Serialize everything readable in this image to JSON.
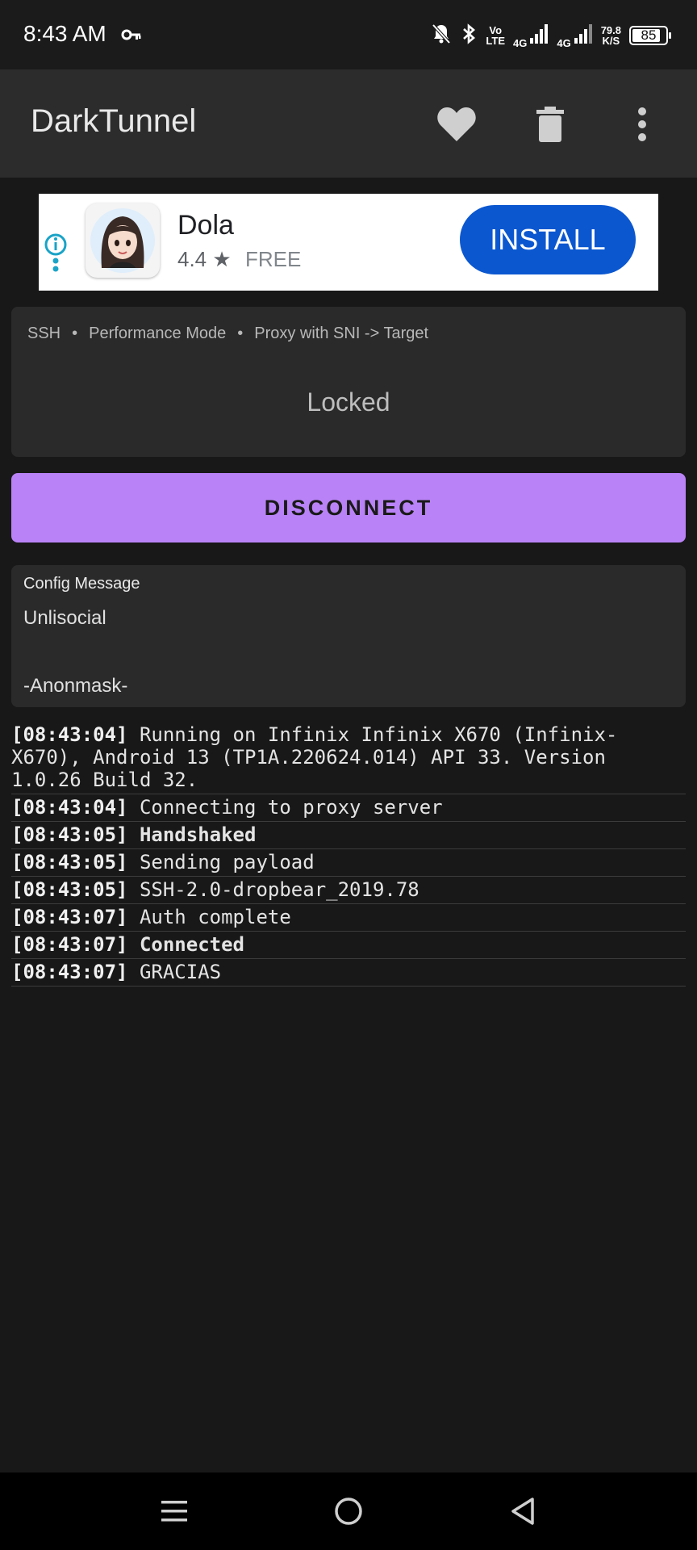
{
  "status_bar": {
    "time": "8:43 AM",
    "volte_top": "Vo",
    "volte_bottom": "LTE",
    "net1": "4G",
    "net2": "4G",
    "speed_value": "79.8",
    "speed_unit": "K/S",
    "battery": "85",
    "icons": [
      "key-icon",
      "bell-off-icon",
      "bluetooth-icon",
      "signal-icon",
      "signal-icon",
      "battery-icon"
    ]
  },
  "app_bar": {
    "title": "DarkTunnel",
    "icons": [
      "heart-icon",
      "trash-icon",
      "more-vert-icon"
    ]
  },
  "ad": {
    "app_name": "Dola",
    "rating": "4.4 ★",
    "price": "FREE",
    "install_label": "INSTALL"
  },
  "mode_card": {
    "crumbs": [
      "SSH",
      "Performance Mode",
      "Proxy with SNI -> Target"
    ],
    "separator": "•",
    "status": "Locked"
  },
  "disconnect_label": "DISCONNECT",
  "config": {
    "label": "Config Message",
    "line1": "Unlisocial",
    "line2": "-Anonmask-"
  },
  "log": [
    {
      "ts": "[08:43:04]",
      "msg": "Running on Infinix Infinix X670 (Infinix-X670), Android 13 (TP1A.220624.014) API 33. Version 1.0.26 Build 32.",
      "bold": false
    },
    {
      "ts": "[08:43:04]",
      "msg": "Connecting to proxy server",
      "bold": false
    },
    {
      "ts": "[08:43:05]",
      "msg": "Handshaked",
      "bold": true
    },
    {
      "ts": "[08:43:05]",
      "msg": "Sending payload",
      "bold": false
    },
    {
      "ts": "[08:43:05]",
      "msg": "SSH-2.0-dropbear_2019.78",
      "bold": false
    },
    {
      "ts": "[08:43:07]",
      "msg": "Auth complete",
      "bold": false
    },
    {
      "ts": "[08:43:07]",
      "msg": "Connected",
      "bold": true
    },
    {
      "ts": "[08:43:07]",
      "msg": "GRACIAS",
      "bold": false
    }
  ],
  "colors": {
    "accent": "#b983f7",
    "install_blue": "#0b57d0",
    "background": "#181818",
    "card": "#2a2a2a"
  }
}
